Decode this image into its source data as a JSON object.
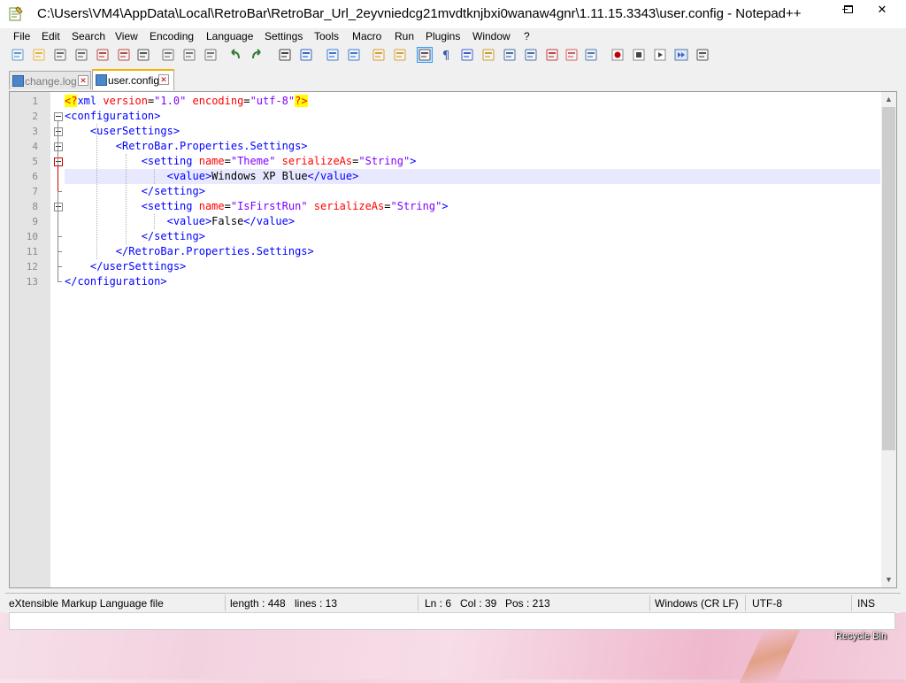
{
  "window": {
    "title": "C:\\Users\\VM4\\AppData\\Local\\RetroBar\\RetroBar_Url_2eyvniedcg21mvdtknjbxi0wanaw4gnr\\1.11.15.3343\\user.config - Notepad++",
    "minimize": "−",
    "maximize": "▭",
    "close": "✕"
  },
  "menu": [
    "File",
    "Edit",
    "Search",
    "View",
    "Encoding",
    "Language",
    "Settings",
    "Tools",
    "Macro",
    "Run",
    "Plugins",
    "Window",
    "?"
  ],
  "tabs": [
    {
      "label": "change.log",
      "active": false
    },
    {
      "label": "user.config",
      "active": true
    }
  ],
  "editor": {
    "line_numbers": [
      "1",
      "2",
      "3",
      "4",
      "5",
      "6",
      "7",
      "8",
      "9",
      "10",
      "11",
      "12",
      "13"
    ],
    "current_line": 6,
    "lines": [
      {
        "indent": "",
        "parts": [
          [
            "decl",
            "<?"
          ],
          [
            "tag",
            "xml"
          ],
          [
            "attr",
            " version"
          ],
          [
            "txt",
            "="
          ],
          [
            "val",
            "\"1.0\""
          ],
          [
            "attr",
            " encoding"
          ],
          [
            "txt",
            "="
          ],
          [
            "val",
            "\"utf-8\""
          ],
          [
            "decl",
            "?>"
          ]
        ]
      },
      {
        "indent": "",
        "parts": [
          [
            "tag",
            "<configuration>"
          ]
        ]
      },
      {
        "indent": "    ",
        "parts": [
          [
            "tag",
            "<userSettings>"
          ]
        ]
      },
      {
        "indent": "        ",
        "parts": [
          [
            "tag",
            "<RetroBar.Properties.Settings>"
          ]
        ]
      },
      {
        "indent": "            ",
        "parts": [
          [
            "tag",
            "<setting"
          ],
          [
            "attr",
            " name"
          ],
          [
            "txt",
            "="
          ],
          [
            "val",
            "\"Theme\""
          ],
          [
            "attr",
            " serializeAs"
          ],
          [
            "txt",
            "="
          ],
          [
            "val",
            "\"String\""
          ],
          [
            "tag",
            ">"
          ]
        ]
      },
      {
        "indent": "                ",
        "parts": [
          [
            "tag",
            "<value>"
          ],
          [
            "txt",
            "Windows XP Blue"
          ],
          [
            "tag",
            "</value>"
          ]
        ]
      },
      {
        "indent": "            ",
        "parts": [
          [
            "tag",
            "</setting>"
          ]
        ]
      },
      {
        "indent": "            ",
        "parts": [
          [
            "tag",
            "<setting"
          ],
          [
            "attr",
            " name"
          ],
          [
            "txt",
            "="
          ],
          [
            "val",
            "\"IsFirstRun\""
          ],
          [
            "attr",
            " serializeAs"
          ],
          [
            "txt",
            "="
          ],
          [
            "val",
            "\"String\""
          ],
          [
            "tag",
            ">"
          ]
        ]
      },
      {
        "indent": "                ",
        "parts": [
          [
            "tag",
            "<value>"
          ],
          [
            "txt",
            "False"
          ],
          [
            "tag",
            "</value>"
          ]
        ]
      },
      {
        "indent": "            ",
        "parts": [
          [
            "tag",
            "</setting>"
          ]
        ]
      },
      {
        "indent": "        ",
        "parts": [
          [
            "tag",
            "</RetroBar.Properties.Settings>"
          ]
        ]
      },
      {
        "indent": "    ",
        "parts": [
          [
            "tag",
            "</userSettings>"
          ]
        ]
      },
      {
        "indent": "",
        "parts": [
          [
            "tag",
            "</configuration>"
          ]
        ]
      }
    ]
  },
  "status": {
    "file_type": "eXtensible Markup Language file",
    "length": "length : 448",
    "lines": "lines : 13",
    "ln": "Ln : 6",
    "col": "Col : 39",
    "pos": "Pos : 213",
    "eol": "Windows (CR LF)",
    "encoding": "UTF-8",
    "mode": "INS"
  },
  "desktop": {
    "recycle_bin": "Recycle Bin"
  },
  "colors": {
    "tag": "#0000ff",
    "attribute": "#ff0000",
    "value": "#8000ff",
    "current_line": "#e8e8ff",
    "active_tab_accent": "#fab000"
  },
  "toolbar_icons": [
    "new-file-icon",
    "open-file-icon",
    "save-icon",
    "save-all-icon",
    "close-icon",
    "close-all-icon",
    "print-icon",
    "cut-icon",
    "copy-icon",
    "paste-icon",
    "undo-icon",
    "redo-icon",
    "find-icon",
    "replace-icon",
    "zoom-in-icon",
    "zoom-out-icon",
    "sync-vertical-icon",
    "sync-horizontal-icon",
    "word-wrap-icon",
    "show-all-chars-icon",
    "indent-guide-icon",
    "user-lang-icon",
    "doc-map-icon",
    "doc-list-icon",
    "function-list-icon",
    "folder-workspace-icon",
    "monitoring-icon",
    "record-macro-icon",
    "stop-record-icon",
    "play-macro-icon",
    "run-macro-multiple-icon",
    "save-macro-icon"
  ]
}
